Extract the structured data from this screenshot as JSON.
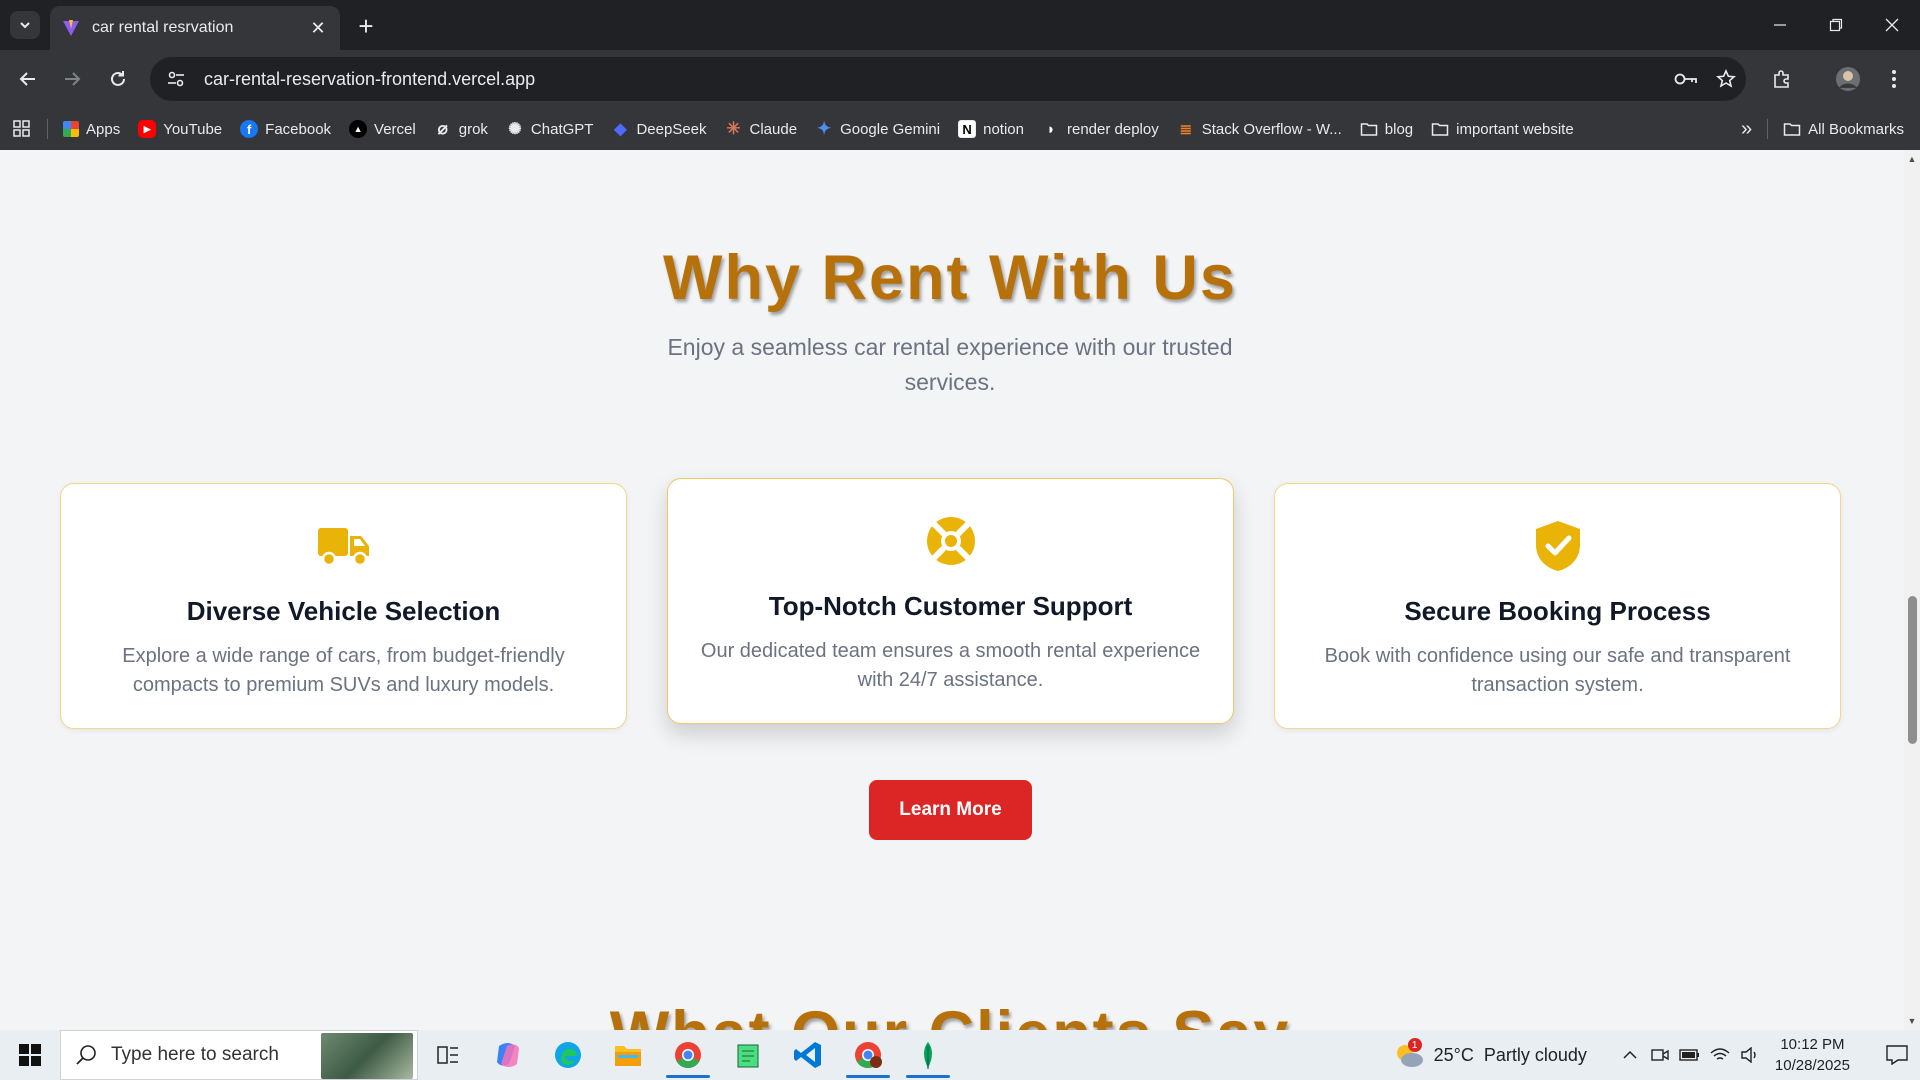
{
  "browser": {
    "tab_title": "car rental resrvation",
    "url": "car-rental-reservation-frontend.vercel.app",
    "bookmarks": [
      {
        "label": "Apps",
        "icon": "apps-grid-icon"
      },
      {
        "label": "YouTube",
        "icon": "youtube-icon"
      },
      {
        "label": "Facebook",
        "icon": "facebook-icon"
      },
      {
        "label": "Vercel",
        "icon": "vercel-icon"
      },
      {
        "label": "grok",
        "icon": "grok-icon"
      },
      {
        "label": "ChatGPT",
        "icon": "chatgpt-icon"
      },
      {
        "label": "DeepSeek",
        "icon": "deepseek-icon"
      },
      {
        "label": "Claude",
        "icon": "claude-icon"
      },
      {
        "label": "Google Gemini",
        "icon": "gemini-icon"
      },
      {
        "label": "notion",
        "icon": "notion-icon"
      },
      {
        "label": "render deploy",
        "icon": "render-icon"
      },
      {
        "label": "Stack Overflow - W...",
        "icon": "stackoverflow-icon"
      },
      {
        "label": "blog",
        "icon": "folder-icon"
      },
      {
        "label": "important website",
        "icon": "folder-icon"
      }
    ],
    "all_bookmarks": "All Bookmarks",
    "overflow": "»"
  },
  "page": {
    "heading": "Why Rent With Us",
    "subheading": "Enjoy a seamless car rental experience with our trusted services.",
    "cards": [
      {
        "title": "Diverse Vehicle Selection",
        "text": "Explore a wide range of cars, from budget-friendly compacts to premium SUVs and luxury models.",
        "icon": "truck-icon"
      },
      {
        "title": "Top-Notch Customer Support",
        "text": "Our dedicated team ensures a smooth rental experience with 24/7 assistance.",
        "icon": "lifebuoy-icon"
      },
      {
        "title": "Secure Booking Process",
        "text": "Book with confidence using our safe and transparent transaction system.",
        "icon": "shield-check-icon"
      }
    ],
    "learn_more": "Learn More",
    "next_heading": "What Our Clients Say",
    "accent_color": "#b7710a",
    "icon_color": "#eab308",
    "button_color": "#dc2626"
  },
  "taskbar": {
    "search_placeholder": "Type here to search",
    "weather": "25°C  Partly cloudy",
    "weather_badge": "1",
    "time": "10:12 PM",
    "date": "10/28/2025"
  }
}
